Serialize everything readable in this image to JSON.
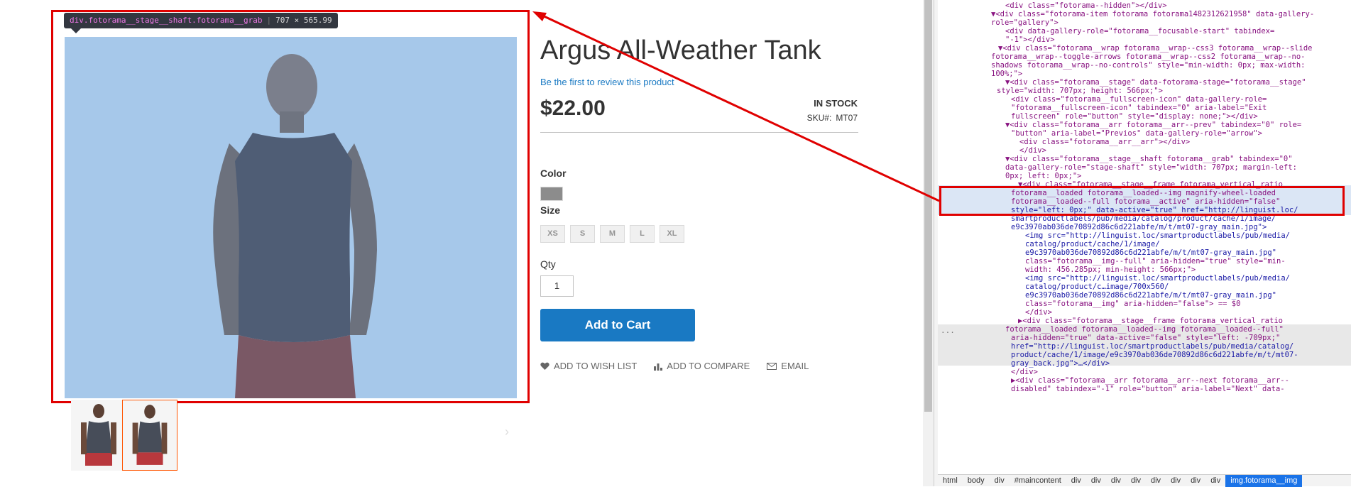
{
  "tooltip": {
    "selector": "div.fotorama__stage__shaft.fotorama__grab",
    "dims": "707 × 565.99"
  },
  "product": {
    "title": "Argus All-Weather Tank",
    "review_link": "Be the first to review this product",
    "price": "$22.00",
    "stock": "IN STOCK",
    "sku_label": "SKU#:",
    "sku_value": "MT07",
    "color_label": "Color",
    "size_label": "Size",
    "sizes": [
      "XS",
      "S",
      "M",
      "L",
      "XL"
    ],
    "qty_label": "Qty",
    "qty_value": "1",
    "add_to_cart": "Add to Cart",
    "wishlist": "ADD TO WISH LIST",
    "compare": "ADD TO COMPARE",
    "email": "EMAIL"
  },
  "devtools": {
    "lines": [
      "<div class=\"fotorama--hidden\"></div>",
      "▼<div class=\"fotorama-item fotorama fotorama1482312621958\" data-gallery-",
      "role=\"gallery\">",
      "<div data-gallery-role=\"fotorama__focusable-start\" tabindex=",
      "\"-1\"></div>",
      "▼<div class=\"fotorama__wrap fotorama__wrap--css3 fotorama__wrap--slide",
      "fotorama__wrap--toggle-arrows fotorama__wrap--css2 fotorama__wrap--no-",
      "shadows fotorama__wrap--no-controls\" style=\"min-width: 0px; max-width:",
      "100%;\">",
      "▼<div class=\"fotorama__stage\" data-fotorama-stage=\"fotorama__stage\"",
      "style=\"width: 707px; height: 566px;\">",
      "<div class=\"fotorama__fullscreen-icon\" data-gallery-role=",
      "\"fotorama__fullscreen-icon\" tabindex=\"0\" aria-label=\"Exit",
      "fullscreen\" role=\"button\" style=\"display: none;\"></div>",
      "▼<div class=\"fotorama__arr fotorama__arr--prev\" tabindex=\"0\" role=",
      "\"button\" aria-label=\"Previos\" data-gallery-role=\"arrow\">",
      "<div class=\"fotorama__arr__arr\"></div>",
      "</div>",
      "▼<div class=\"fotorama__stage__shaft fotorama__grab\" tabindex=\"0\"",
      "data-gallery-role=\"stage-shaft\" style=\"width: 707px; margin-left:",
      "0px; left: 0px;\">",
      "▼<div class=\"fotorama__stage__frame fotorama_vertical_ratio",
      "fotorama__loaded fotorama__loaded--img magnify-wheel-loaded",
      "fotorama__loaded--full fotorama__active\" aria-hidden=\"false\"",
      "style=\"left: 0px;\" data-active=\"true\" href=\"http://linguist.loc/",
      "smartproductlabels/pub/media/catalog/product/cache/1/image/",
      "e9c3970ab036de70892d86c6d221abfe/m/t/mt07-gray_main.jpg\">",
      "<img src=\"http://linguist.loc/smartproductlabels/pub/media/",
      "catalog/product/cache/1/image/",
      "e9c3970ab036de70892d86c6d221abfe/m/t/mt07-gray_main.jpg\"",
      "class=\"fotorama__img--full\" aria-hidden=\"true\" style=\"min-",
      "width: 456.285px; min-height: 566px;\">",
      "<img src=\"http://linguist.loc/smartproductlabels/pub/media/",
      "catalog/product/c…image/700x560/",
      "e9c3970ab036de70892d86c6d221abfe/m/t/mt07-gray_main.jpg\"",
      "class=\"fotorama__img\" aria-hidden=\"false\"> == $0",
      "</div>",
      "▶<div class=\"fotorama__stage__frame fotorama_vertical_ratio",
      "fotorama__loaded fotorama__loaded--img fotorama__loaded--full\"",
      "aria-hidden=\"true\" data-active=\"false\" style=\"left: -709px;\"",
      "href=\"http://linguist.loc/smartproductlabels/pub/media/catalog/",
      "product/cache/1/image/e9c3970ab036de70892d86c6d221abfe/m/t/mt07-",
      "gray_back.jpg\">…</div>",
      "</div>",
      "▶<div class=\"fotorama__arr fotorama__arr--next fotorama__arr--",
      "disabled\" tabindex=\"-1\" role=\"button\" aria-label=\"Next\" data-"
    ],
    "ellipsis": "...",
    "breadcrumbs": [
      "html",
      "body",
      "div",
      "#maincontent",
      "div",
      "div",
      "div",
      "div",
      "div",
      "div",
      "div",
      "div",
      "img.fotorama__img"
    ]
  },
  "colors": {
    "highlight": "#e00000",
    "link": "#1979c3",
    "overlay": "#a6c8ea"
  }
}
